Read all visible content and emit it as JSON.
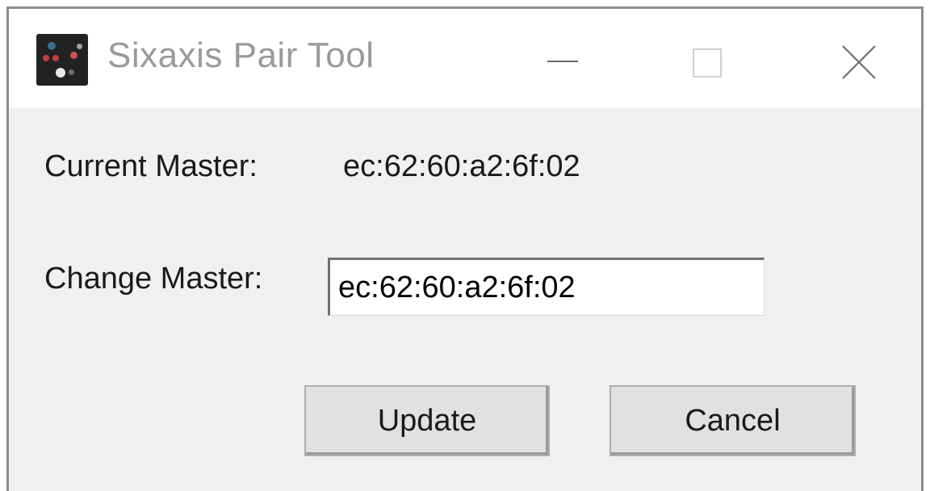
{
  "window": {
    "title": "Sixaxis Pair Tool",
    "icon": "gamepad-app-icon",
    "controls": [
      "minimize-icon",
      "maximize-icon",
      "close-icon"
    ]
  },
  "current_master": {
    "label": "Current Master:",
    "value": "ec:62:60:a2:6f:02"
  },
  "change_master": {
    "label": "Change Master:",
    "input_value": "ec:62:60:a2:6f:02"
  },
  "buttons": {
    "update": "Update",
    "cancel": "Cancel"
  },
  "colors": {
    "titlebar_bg": "#ffffff",
    "client_bg": "#f0f0f0",
    "title_text": "#9a9a9a",
    "button_bg": "#e1e1e1"
  }
}
